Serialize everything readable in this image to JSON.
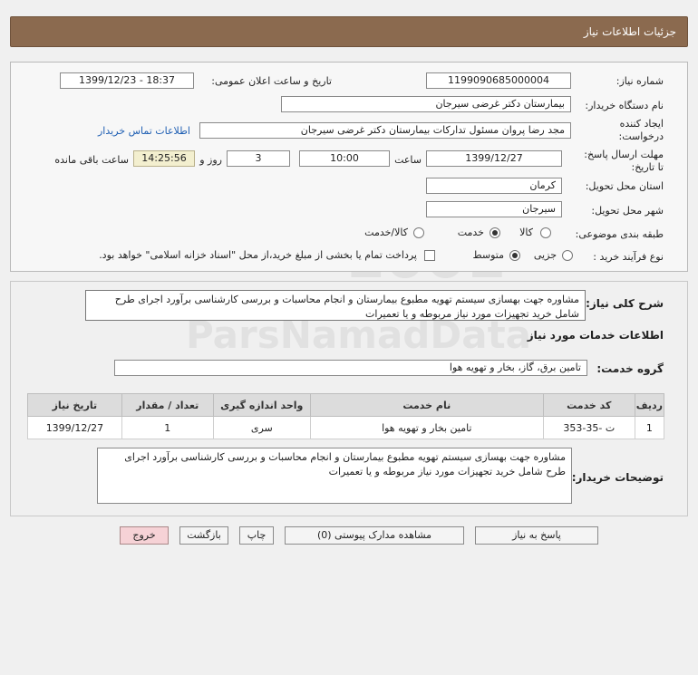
{
  "header": {
    "title": "جزئیات اطلاعات نیاز"
  },
  "form": {
    "need_number_label": "شماره نیاز:",
    "need_number": "1199090685000004",
    "announce_label": "تاریخ و ساعت اعلان عمومی:",
    "announce_value": "1399/12/23 - 18:37",
    "buyer_org_label": "نام دستگاه خریدار:",
    "buyer_org": "بیمارستان دکتر غرضی سیرجان",
    "requester_label_1": "ایجاد کننده",
    "requester_label_2": "درخواست:",
    "requester": "مجد رضا پروان مسئول تدارکات بیمارستان دکتر غرضی سیرجان",
    "contact_link": "اطلاعات تماس خریدار",
    "deadline_label_1": "مهلت ارسال پاسخ:",
    "deadline_label_2": "تا تاریخ:",
    "deadline_date": "1399/12/27",
    "time_label": "ساعت",
    "deadline_time": "10:00",
    "days_value": "3",
    "days_label": "روز و",
    "remaining_time": "14:25:56",
    "remaining_label": "ساعت باقی مانده",
    "province_label": "استان محل تحویل:",
    "province": "کرمان",
    "city_label": "شهر محل تحویل:",
    "city": "سیرجان",
    "category_label": "طبقه بندی موضوعی:",
    "category_options": [
      "کالا",
      "خدمت",
      "کالا/خدمت"
    ],
    "category_selected": "خدمت",
    "process_label": "نوع فرآیند خرید :",
    "process_options": [
      "جزیی",
      "متوسط"
    ],
    "process_selected": "متوسط",
    "payment_note": "پرداخت تمام یا بخشی از مبلغ خرید،از محل \"اسناد خزانه اسلامی\" خواهد بود."
  },
  "summary": {
    "label": "شرح کلی نیاز:",
    "text": "مشاوره جهت بهسازی سیستم تهویه مطبوع بیمارستان و انجام محاسبات و بررسی کارشناسی برآورد اجرای طرح شامل خرید تجهیزات مورد نیاز مربوطه و یا تعمیرات"
  },
  "services": {
    "heading": "اطلاعات خدمات مورد نیاز",
    "group_label": "گروه خدمت:",
    "group_value": "تامین برق، گاز، بخار و تهویه هوا",
    "columns": [
      "ردیف",
      "کد خدمت",
      "نام خدمت",
      "واحد اندازه گیری",
      "تعداد / مقدار",
      "تاریخ نیاز"
    ],
    "rows": [
      {
        "row": "1",
        "code": "ت -35-353",
        "name": "تامین بخار و تهویه هوا",
        "unit": "سری",
        "qty": "1",
        "date": "1399/12/27"
      }
    ]
  },
  "buyer_notes": {
    "label": "توضیحات خریدار:",
    "text": "مشاوره جهت بهسازی سیستم تهویه مطبوع بیمارستان و انجام محاسبات و بررسی کارشناسی برآورد اجرای طرح شامل خرید تجهیزات مورد نیاز مربوطه و یا تعمیرات"
  },
  "buttons": {
    "reply": "پاسخ به نیاز",
    "attachments": "مشاهده مدارک پیوستی (0)",
    "print": "چاپ",
    "back": "بازگشت",
    "exit": "خروج"
  },
  "colors": {
    "titlebar": "#8b6a4f",
    "link": "#1f5fb3",
    "exit_button": "#f6d2d6"
  }
}
